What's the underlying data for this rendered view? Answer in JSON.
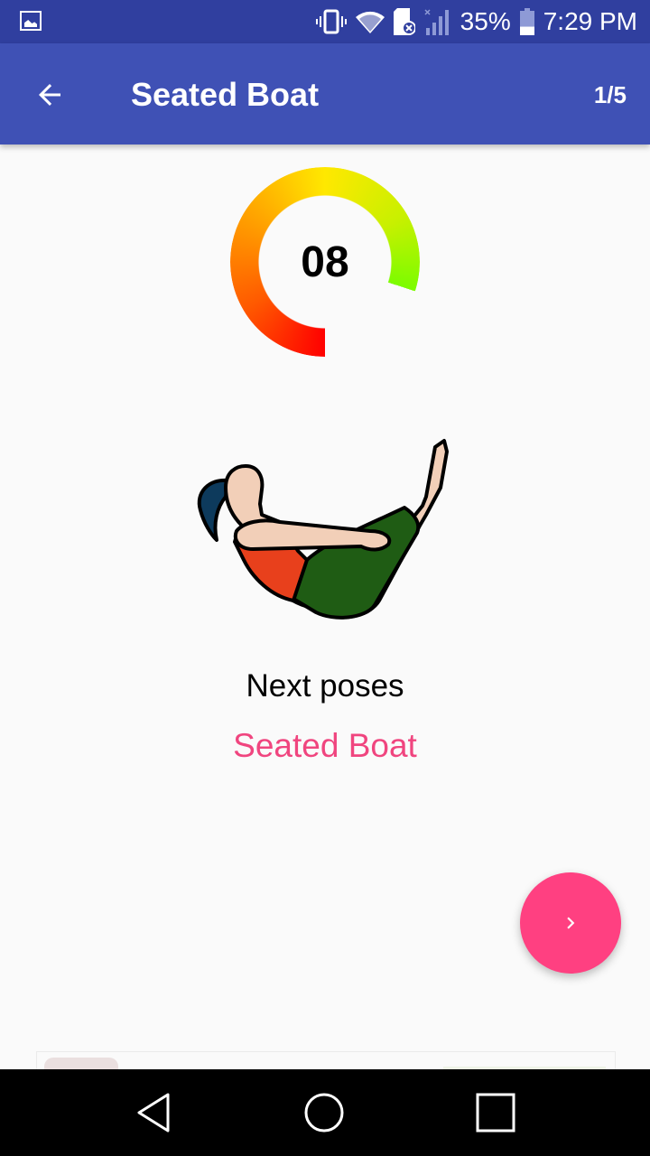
{
  "status_bar": {
    "notification_icon": "gallery-icon",
    "icons": [
      "vibrate-icon",
      "wifi-icon",
      "sd-card-error-icon",
      "signal-no-service-icon"
    ],
    "battery_percent": "35%",
    "battery_level": 0.35,
    "time": "7:29 PM"
  },
  "app_bar": {
    "back_icon": "arrow-back-icon",
    "title": "Seated Boat",
    "progress": "1/5"
  },
  "timer": {
    "value": "08",
    "colors": [
      "#ff0000",
      "#ffa000",
      "#ffe800",
      "#7cfc00"
    ]
  },
  "pose": {
    "illustration": "seated-boat-pose-illustration"
  },
  "next": {
    "label": "Next poses",
    "name": "Seated Boat",
    "name_color": "#f0457f"
  },
  "fab": {
    "icon": "chevron-right-icon",
    "color": "#ff4081"
  },
  "nav_bar": {
    "buttons": [
      "back-nav-icon",
      "home-nav-icon",
      "recents-nav-icon"
    ]
  },
  "theme": {
    "primary": "#3f51b5",
    "primary_dark": "#303f9f",
    "accent": "#ff4081"
  }
}
